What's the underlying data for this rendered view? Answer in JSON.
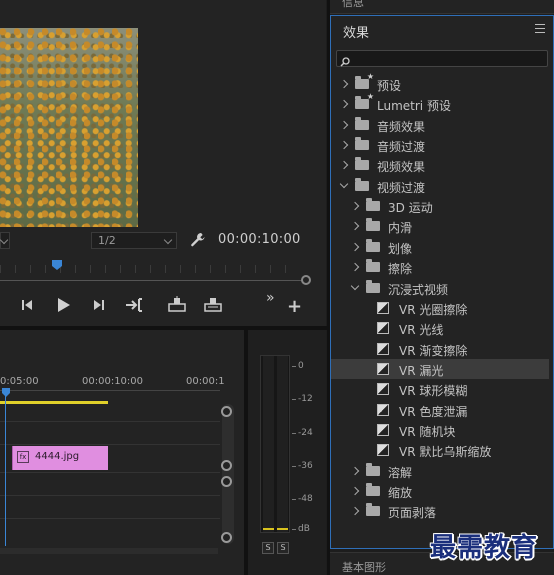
{
  "monitor": {
    "resolution_dropdown": "1/2",
    "timecode": "00:00:10:00",
    "wrench_icon": "wrench-icon",
    "transport": {
      "step_back": "step-back-icon",
      "play": "play-icon",
      "step_forward": "step-forward-icon",
      "go_to_out": "go-to-out-icon",
      "lift": "lift-icon",
      "extract": "extract-icon",
      "more": "»",
      "add": "+"
    }
  },
  "timeline": {
    "ruler_labels": [
      "0:05:00",
      "00:00:10:00",
      "00:00:1"
    ],
    "clip_name": "4444.jpg",
    "clip_fx": "fx",
    "clip_color": "#e08ee0",
    "playhead_color": "#3a86d6",
    "work_area_color": "#e0d02a"
  },
  "meter": {
    "scale": [
      "0",
      "-12",
      "-24",
      "-36",
      "-48",
      "dB"
    ],
    "solo_left": "S",
    "solo_right": "S"
  },
  "top_tab": "信息",
  "effects": {
    "title": "效果",
    "search_placeholder": "",
    "tree": [
      {
        "label": "预设",
        "type": "folder-star",
        "level": 0,
        "open": false
      },
      {
        "label": "Lumetri 预设",
        "type": "folder-star",
        "level": 0,
        "open": false
      },
      {
        "label": "音频效果",
        "type": "folder",
        "level": 0,
        "open": false
      },
      {
        "label": "音频过渡",
        "type": "folder",
        "level": 0,
        "open": false
      },
      {
        "label": "视频效果",
        "type": "folder",
        "level": 0,
        "open": false
      },
      {
        "label": "视频过渡",
        "type": "folder",
        "level": 0,
        "open": true
      },
      {
        "label": "3D 运动",
        "type": "folder",
        "level": 1,
        "open": false
      },
      {
        "label": "内滑",
        "type": "folder",
        "level": 1,
        "open": false
      },
      {
        "label": "划像",
        "type": "folder",
        "level": 1,
        "open": false
      },
      {
        "label": "擦除",
        "type": "folder",
        "level": 1,
        "open": false
      },
      {
        "label": "沉浸式视频",
        "type": "folder",
        "level": 1,
        "open": true
      },
      {
        "label": "VR 光圈擦除",
        "type": "transition",
        "level": 2
      },
      {
        "label": "VR 光线",
        "type": "transition",
        "level": 2
      },
      {
        "label": "VR 渐变擦除",
        "type": "transition",
        "level": 2
      },
      {
        "label": "VR 漏光",
        "type": "transition",
        "level": 2,
        "selected": true
      },
      {
        "label": "VR 球形模糊",
        "type": "transition",
        "level": 2
      },
      {
        "label": "VR 色度泄漏",
        "type": "transition",
        "level": 2
      },
      {
        "label": "VR 随机块",
        "type": "transition",
        "level": 2
      },
      {
        "label": "VR 默比乌斯缩放",
        "type": "transition",
        "level": 2
      },
      {
        "label": "溶解",
        "type": "folder",
        "level": 1,
        "open": false
      },
      {
        "label": "缩放",
        "type": "folder",
        "level": 1,
        "open": false
      },
      {
        "label": "页面剥落",
        "type": "folder",
        "level": 1,
        "open": false
      }
    ]
  },
  "bottom_tab": "基本图形",
  "watermark": "最需教育"
}
